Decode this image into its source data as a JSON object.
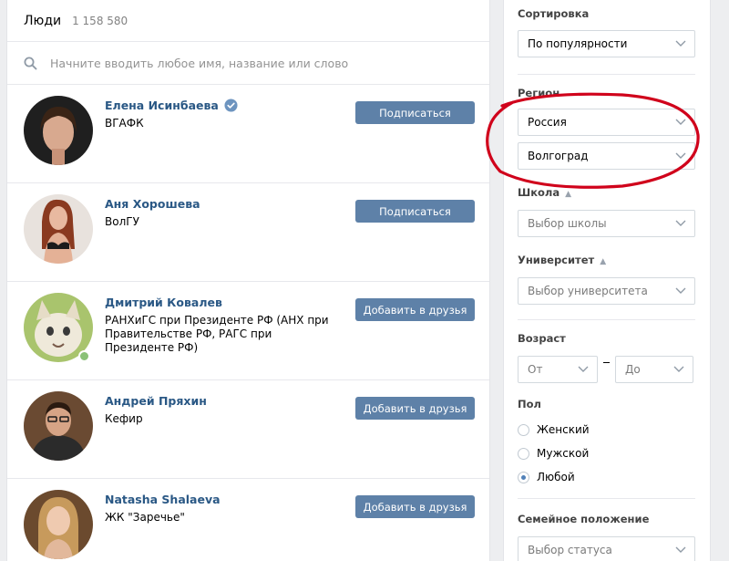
{
  "header": {
    "title": "Люди",
    "count": "1 158 580"
  },
  "search": {
    "placeholder": "Начните вводить любое имя, название или слово",
    "icon": "search-icon"
  },
  "people": [
    {
      "name": "Елена Исинбаева",
      "verified": true,
      "sub": "ВГАФК",
      "button": "Подписаться",
      "online": false
    },
    {
      "name": "Аня Хорошева",
      "verified": false,
      "sub": "ВолГУ",
      "button": "Подписаться",
      "online": false
    },
    {
      "name": "Дмитрий Ковалев",
      "verified": false,
      "sub": "РАНХиГС при Президенте РФ (АНХ при Правительстве РФ, РАГС при Президенте РФ)",
      "button": "Добавить в друзья",
      "online": true
    },
    {
      "name": "Андрей Пряхин",
      "verified": false,
      "sub": "Кефир",
      "button": "Добавить в друзья",
      "online": false
    },
    {
      "name": "Natasha Shalaeva",
      "verified": false,
      "sub": "ЖК \"Заречье\"",
      "button": "Добавить в друзья",
      "online": false
    }
  ],
  "sidebar": {
    "sort": {
      "label": "Сортировка",
      "value": "По популярности"
    },
    "region": {
      "label": "Регион",
      "country": "Россия",
      "city": "Волгоград"
    },
    "school": {
      "label": "Школа",
      "placeholder": "Выбор школы"
    },
    "university": {
      "label": "Университет",
      "placeholder": "Выбор университета"
    },
    "age": {
      "label": "Возраст",
      "from": "От",
      "to": "До"
    },
    "gender": {
      "label": "Пол",
      "options": [
        "Женский",
        "Мужской",
        "Любой"
      ],
      "selected": "Любой"
    },
    "family": {
      "label": "Семейное положение",
      "placeholder": "Выбор статуса"
    }
  },
  "colors": {
    "link": "#2a5885",
    "button": "#5e81a8",
    "highlight": "#d0021b"
  }
}
